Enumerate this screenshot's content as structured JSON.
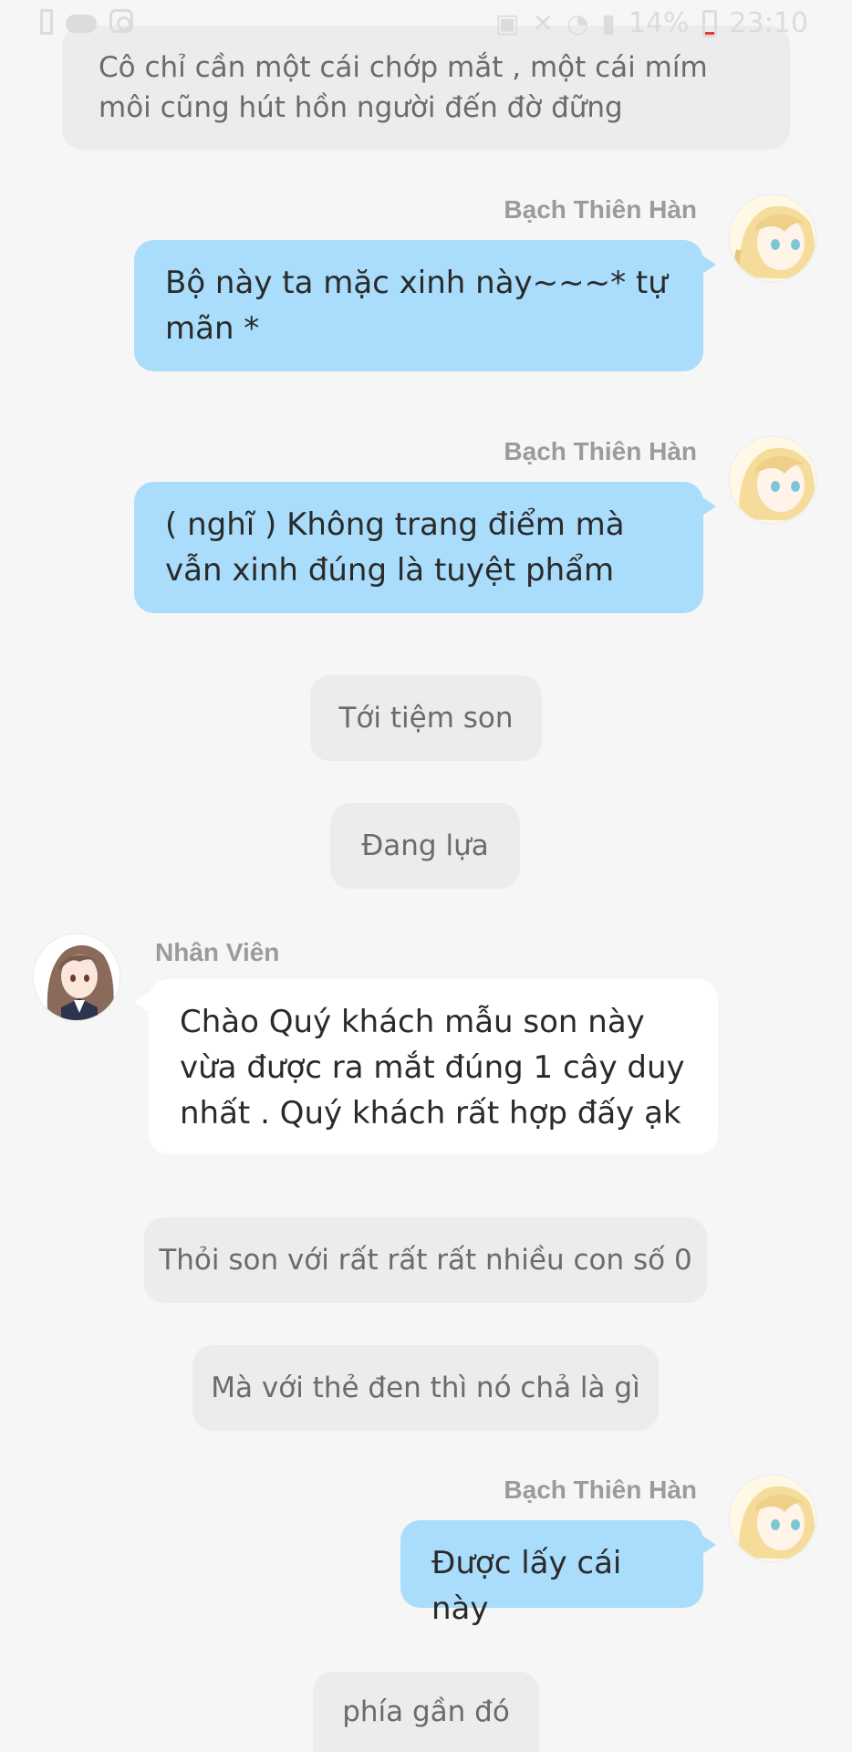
{
  "status_bar": {
    "battery": "14%",
    "time": "23:10"
  },
  "messages": {
    "narration_top": "Cô chỉ cần một cái chớp mắt , một cái mím môi cũng hút hồn người đến đờ đững",
    "msg1": {
      "name": "Bạch Thiên Hàn",
      "text": "Bộ này ta mặc xinh này~~~* tự mãn *"
    },
    "msg2": {
      "name": "Bạch Thiên Hàn",
      "text": "( nghĩ ) Không trang điểm mà vẫn xinh đúng là tuyệt phẩm"
    },
    "narration2": "Tới tiệm son",
    "narration3": "Đang lựa",
    "msg3": {
      "name": "Nhân Viên",
      "text": "Chào Quý khách mẫu son này vừa được ra mắt đúng 1 cây duy nhất . Quý khách rất hợp đấy ạk"
    },
    "narration4": "Thỏi son với rất rất rất nhiều con số 0",
    "narration5": "Mà với thẻ đen thì nó chả là gì",
    "msg4": {
      "name": "Bạch Thiên Hàn",
      "text": "Được lấy cái này"
    },
    "narration6": "phía gần đó"
  },
  "colors": {
    "background": "#f6f6f6",
    "narration_bg": "#ececec",
    "bubble_self": "#a9ddfb",
    "bubble_other": "#ffffff",
    "name": "#9b9b9b"
  }
}
